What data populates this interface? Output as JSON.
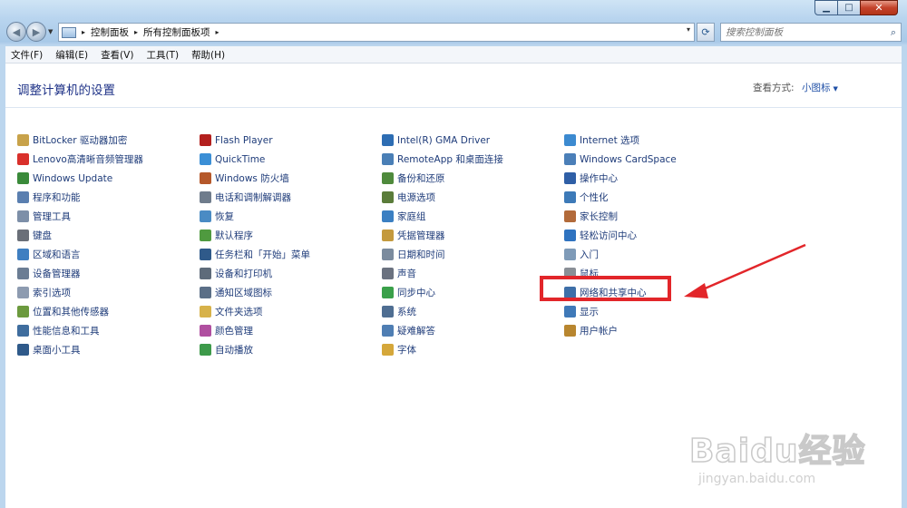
{
  "window": {
    "caption_buttons": [
      {
        "name": "minimize",
        "glyph": "▁"
      },
      {
        "name": "maximize",
        "glyph": "□"
      },
      {
        "name": "close",
        "glyph": "✕"
      }
    ]
  },
  "address_bar": {
    "separator": "▸",
    "crumbs": [
      "控制面板",
      "所有控制面板项"
    ],
    "dropdown": "▾",
    "refresh_icon": "refresh-icon"
  },
  "search": {
    "placeholder": "搜索控制面板",
    "icon": "search-icon"
  },
  "menu": [
    "文件(F)",
    "编辑(E)",
    "查看(V)",
    "工具(T)",
    "帮助(H)"
  ],
  "page": {
    "heading": "调整计算机的设置",
    "view_by_label": "查看方式:",
    "view_by_value": "小图标"
  },
  "columns": [
    {
      "items": [
        {
          "label": "BitLocker 驱动器加密",
          "icon": "bitlocker-icon",
          "color": "#c8a24a"
        },
        {
          "label": "Lenovo高清晰音频管理器",
          "icon": "audio-manager-icon",
          "color": "#d9302b"
        },
        {
          "label": "Windows Update",
          "icon": "windows-update-icon",
          "color": "#3a8a3a"
        },
        {
          "label": "程序和功能",
          "icon": "programs-icon",
          "color": "#5a7fb0"
        },
        {
          "label": "管理工具",
          "icon": "admin-tools-icon",
          "color": "#7d8fa8"
        },
        {
          "label": "键盘",
          "icon": "keyboard-icon",
          "color": "#6a6f78"
        },
        {
          "label": "区域和语言",
          "icon": "region-icon",
          "color": "#3f7fc1"
        },
        {
          "label": "设备管理器",
          "icon": "device-manager-icon",
          "color": "#6b7d94"
        },
        {
          "label": "索引选项",
          "icon": "index-icon",
          "color": "#8d9bb0"
        },
        {
          "label": "位置和其他传感器",
          "icon": "sensor-icon",
          "color": "#6c9a3e"
        },
        {
          "label": "性能信息和工具",
          "icon": "performance-icon",
          "color": "#3f6d9e"
        },
        {
          "label": "桌面小工具",
          "icon": "gadgets-icon",
          "color": "#2f5a8a"
        }
      ]
    },
    {
      "items": [
        {
          "label": "Flash Player",
          "icon": "flash-icon",
          "color": "#b3201e"
        },
        {
          "label": "QuickTime",
          "icon": "quicktime-icon",
          "color": "#3b8fd6"
        },
        {
          "label": "Windows 防火墙",
          "icon": "firewall-icon",
          "color": "#b5582a"
        },
        {
          "label": "电话和调制解调器",
          "icon": "phone-icon",
          "color": "#6f7c8c"
        },
        {
          "label": "恢复",
          "icon": "recovery-icon",
          "color": "#4a8bc4"
        },
        {
          "label": "默认程序",
          "icon": "default-programs-icon",
          "color": "#4f9a3f"
        },
        {
          "label": "任务栏和「开始」菜单",
          "icon": "taskbar-icon",
          "color": "#2f5a8a"
        },
        {
          "label": "设备和打印机",
          "icon": "printer-icon",
          "color": "#5e6b7a"
        },
        {
          "label": "通知区域图标",
          "icon": "notification-icon",
          "color": "#5b6f87"
        },
        {
          "label": "文件夹选项",
          "icon": "folder-options-icon",
          "color": "#d7b24a"
        },
        {
          "label": "颜色管理",
          "icon": "color-management-icon",
          "color": "#b04fa0"
        },
        {
          "label": "自动播放",
          "icon": "autoplay-icon",
          "color": "#3d9a4a"
        }
      ]
    },
    {
      "items": [
        {
          "label": "Intel(R) GMA Driver",
          "icon": "intel-icon",
          "color": "#2d6db3"
        },
        {
          "label": "RemoteApp 和桌面连接",
          "icon": "remoteapp-icon",
          "color": "#4a7fb6"
        },
        {
          "label": "备份和还原",
          "icon": "backup-icon",
          "color": "#4f8a3c"
        },
        {
          "label": "电源选项",
          "icon": "power-icon",
          "color": "#5a7c3a"
        },
        {
          "label": "家庭组",
          "icon": "homegroup-icon",
          "color": "#3b7fc2"
        },
        {
          "label": "凭据管理器",
          "icon": "credential-icon",
          "color": "#c49a3e"
        },
        {
          "label": "日期和时间",
          "icon": "clock-icon",
          "color": "#7b8b9e"
        },
        {
          "label": "声音",
          "icon": "sound-icon",
          "color": "#6b7280"
        },
        {
          "label": "同步中心",
          "icon": "sync-icon",
          "color": "#3aa04a"
        },
        {
          "label": "系统",
          "icon": "system-icon",
          "color": "#4f6e92"
        },
        {
          "label": "疑难解答",
          "icon": "troubleshoot-icon",
          "color": "#4f7eb3"
        },
        {
          "label": "字体",
          "icon": "fonts-icon",
          "color": "#d5a73a"
        }
      ]
    },
    {
      "items": [
        {
          "label": "Internet 选项",
          "icon": "internet-options-icon",
          "color": "#3c8ad0"
        },
        {
          "label": "Windows CardSpace",
          "icon": "cardspace-icon",
          "color": "#4b7fb8"
        },
        {
          "label": "操作中心",
          "icon": "action-center-icon",
          "color": "#2f5fa6"
        },
        {
          "label": "个性化",
          "icon": "personalization-icon",
          "color": "#3d7ab8"
        },
        {
          "label": "家长控制",
          "icon": "parental-controls-icon",
          "color": "#b26a3a"
        },
        {
          "label": "轻松访问中心",
          "icon": "ease-of-access-icon",
          "color": "#2f73c0"
        },
        {
          "label": "入门",
          "icon": "getting-started-icon",
          "color": "#7f9bb8"
        },
        {
          "label": "鼠标",
          "icon": "mouse-icon",
          "color": "#8a8f96"
        },
        {
          "label": "网络和共享中心",
          "icon": "network-sharing-icon",
          "color": "#3e6fa8"
        },
        {
          "label": "显示",
          "icon": "display-icon",
          "color": "#3f79b8"
        },
        {
          "label": "用户帐户",
          "icon": "user-accounts-icon",
          "color": "#b8862f"
        }
      ]
    }
  ],
  "annotation": {
    "highlight_color": "#e2262a"
  },
  "watermark": {
    "logo_text": "Baidu经验",
    "url_text": "jingyan.baidu.com"
  }
}
